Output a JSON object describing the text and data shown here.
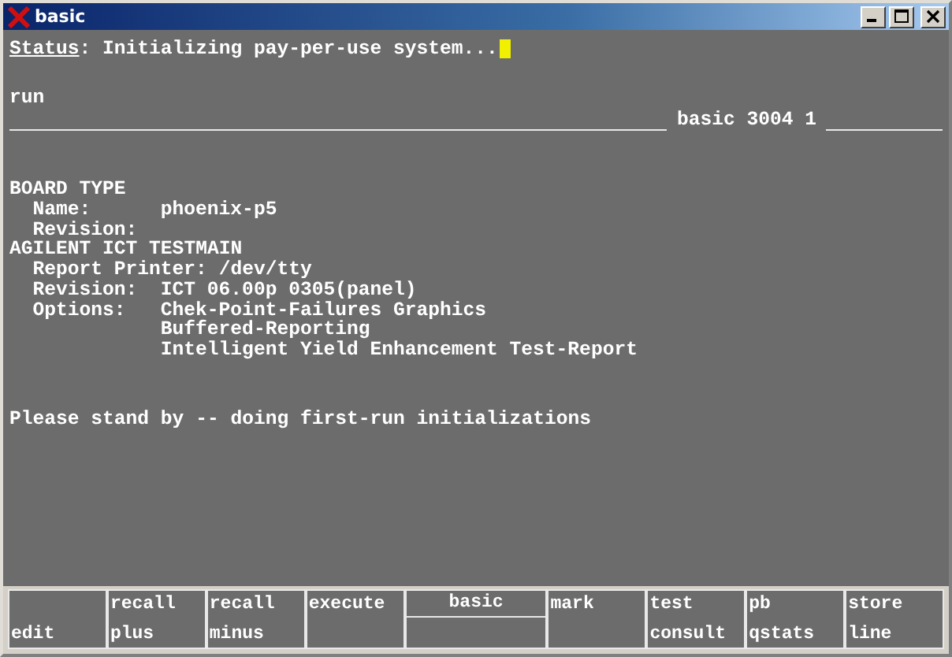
{
  "window": {
    "title": "basic"
  },
  "terminal": {
    "status_label": "Status",
    "status_text": ": Initializing pay-per-use system...",
    "command": "run",
    "prompt_label": "basic 3004 1",
    "sections": [
      {
        "heading": "BOARD TYPE",
        "fields": [
          {
            "label": "Name:",
            "values": [
              "phoenix-p5"
            ]
          },
          {
            "label": "Revision:"
          }
        ]
      },
      {
        "heading": "AGILENT ICT TESTMAIN",
        "fields": [
          {
            "label": "Report Printer:",
            "values": [
              "/dev/tty"
            ]
          },
          {
            "label": "Revision:",
            "values": [
              "ICT 06.00p 0305(panel)"
            ]
          },
          {
            "label": "Options:",
            "values": [
              "Chek-Point-Failures Graphics",
              "Buffered-Reporting",
              "Intelligent Yield Enhancement Test-Report"
            ]
          }
        ]
      }
    ],
    "message": "Please stand by -- doing first-run initializations"
  },
  "softkeys": [
    {
      "kind": "plain",
      "bottom": "edit"
    },
    {
      "kind": "plain",
      "top": "recall",
      "bottom": "plus"
    },
    {
      "kind": "plain",
      "top": "recall",
      "bottom": "minus"
    },
    {
      "kind": "plain",
      "top": "execute"
    },
    {
      "kind": "split",
      "top": "basic"
    },
    {
      "kind": "plain",
      "top": "mark"
    },
    {
      "kind": "plain",
      "top": "test",
      "bottom": "consult"
    },
    {
      "kind": "plain",
      "top": "pb",
      "bottom": "qstats"
    },
    {
      "kind": "plain",
      "top": "store",
      "bottom": "line"
    }
  ]
}
